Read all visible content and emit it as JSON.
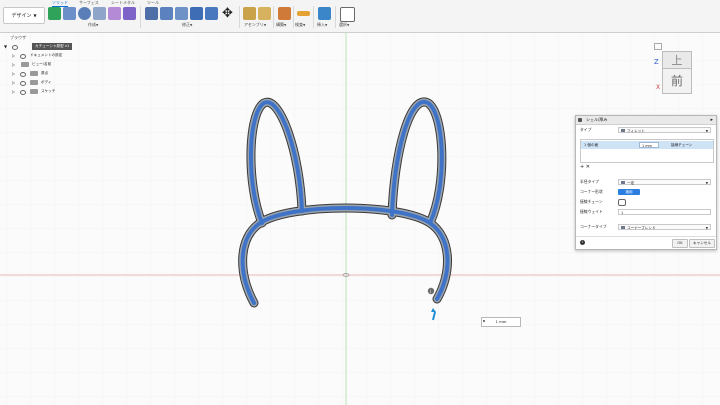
{
  "toolbar": {
    "workspace": "デザイン",
    "tabs": [
      "ソリッド",
      "サーフェス",
      "シートメタル",
      "ツール"
    ],
    "groups": [
      {
        "label": "作成"
      },
      {
        "label": "修正"
      },
      {
        "label": "アセンブリ"
      },
      {
        "label": "構築"
      },
      {
        "label": "検査"
      },
      {
        "label": "挿入"
      },
      {
        "label": "選択"
      }
    ]
  },
  "browser": {
    "title": "ブラウザ",
    "root": "カチューシャ原型 v1",
    "items": [
      "ドキュメントの設定",
      "ビュー/名前",
      "原点",
      "ボディ",
      "スケッチ"
    ]
  },
  "viewcube": {
    "top": "上",
    "front": "前",
    "axis_z": "Z",
    "axis_x": "X"
  },
  "dialog": {
    "title": "シェル/厚み",
    "type_label": "タイプ",
    "type_value": "フィレット",
    "selection": {
      "col1": "1 個の面",
      "value": "1 mm",
      "col3": "接線チェーン"
    },
    "radius_type_label": "半径タイプ",
    "radius_type_value": "一定",
    "corner_label": "コーナー形状",
    "corner_value": "適用",
    "tangent_label": "接線チェーン",
    "weight_label": "接線ウェイト",
    "weight_value": "1",
    "corner_type_label": "コーナータイプ",
    "corner_type_value": "コーナーブレンド",
    "ok": "OK",
    "cancel": "キャンセル"
  },
  "dimension_input": "1 mm",
  "colors": {
    "accent": "#2a7de1",
    "body_blue": "#3f73c8",
    "axis_red": "#d97b7b",
    "axis_green": "#8dd08d"
  }
}
